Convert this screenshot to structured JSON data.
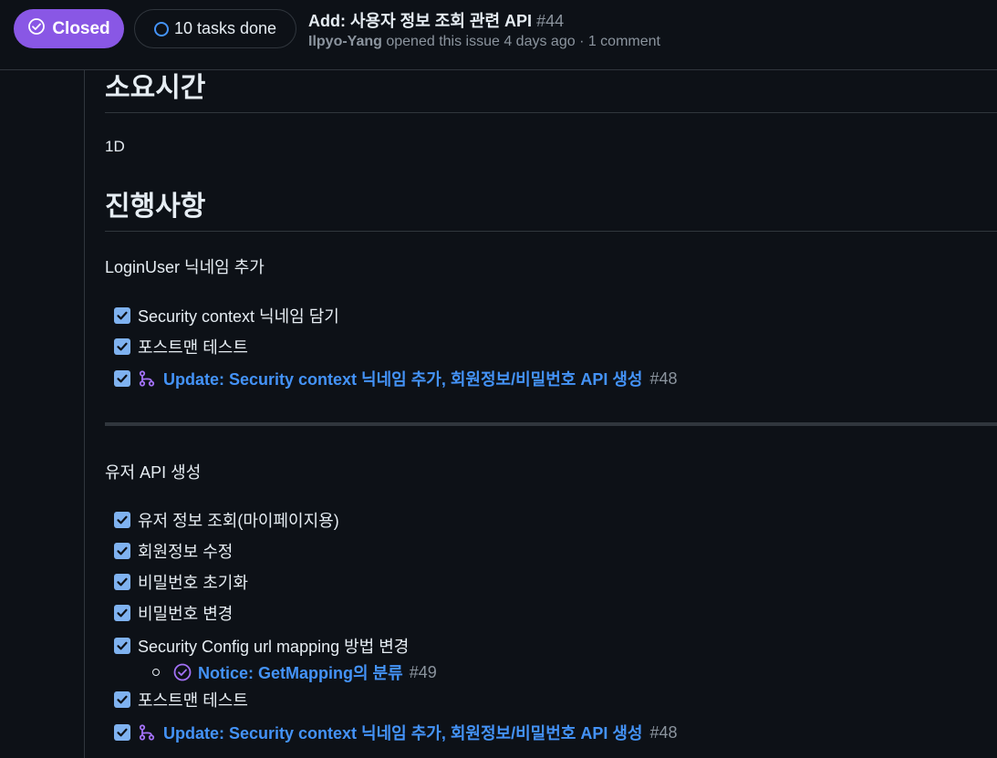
{
  "header": {
    "state_label": "Closed",
    "tasks_label": "10 tasks done",
    "title": "Add: 사용자 정보 조회 관련 API",
    "number": "#44",
    "author": "Ilpyo-Yang",
    "meta_text": "opened this issue 4 days ago · 1 comment"
  },
  "colors": {
    "closed_badge": "#8957e5",
    "link": "#4493f8",
    "checkbox": "#7fb2f0",
    "background": "#0d1117"
  },
  "body": {
    "heading_time": "소요시간",
    "time_value": "1D",
    "heading_progress": "진행사항",
    "section1_title": "LoginUser 닉네임 추가",
    "section1_tasks": [
      {
        "text": "Security context 닉네임 담기",
        "checked": true
      },
      {
        "text": "포스트맨 테스트",
        "checked": true
      },
      {
        "link": "Update: Security context 닉네임 추가, 회원정보/비밀번호 API 생성",
        "ref": "#48",
        "icon": "pull-request-icon",
        "checked": true
      }
    ],
    "section2_title": "유저 API 생성",
    "section2_tasks": [
      {
        "text": "유저 정보 조회(마이페이지용)",
        "checked": true
      },
      {
        "text": "회원정보 수정",
        "checked": true
      },
      {
        "text": "비밀번호 초기화",
        "checked": true
      },
      {
        "text": "비밀번호 변경",
        "checked": true
      },
      {
        "text": "Security Config url mapping 방법 변경",
        "checked": true
      },
      {
        "text": "포스트맨 테스트",
        "checked": true
      },
      {
        "link": "Update: Security context 닉네임 추가, 회원정보/비밀번호 API 생성",
        "ref": "#48",
        "icon": "pull-request-icon",
        "checked": true
      }
    ],
    "subitem": {
      "link": "Notice: GetMapping의 분류",
      "ref": "#49",
      "icon": "issue-closed-icon"
    }
  }
}
